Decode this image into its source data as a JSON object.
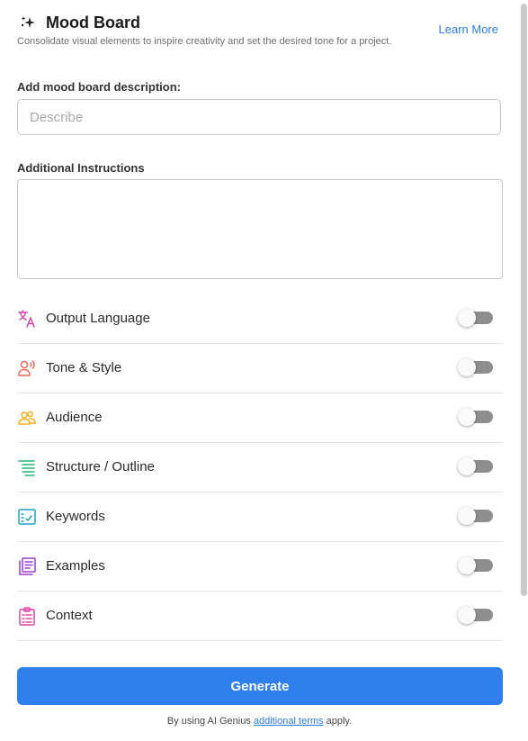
{
  "header": {
    "title": "Mood Board",
    "subtitle": "Consolidate visual elements to inspire creativity and set the desired tone for a project.",
    "learn_more": "Learn More"
  },
  "description": {
    "label": "Add mood board description:",
    "placeholder": "Describe",
    "value": ""
  },
  "instructions": {
    "label": "Additional Instructions",
    "value": ""
  },
  "options": [
    {
      "label": "Output Language",
      "icon": "translate-icon",
      "color": "#d63fa8",
      "enabled": false
    },
    {
      "label": "Tone & Style",
      "icon": "speaking-person-icon",
      "color": "#ef6b5b",
      "enabled": false
    },
    {
      "label": "Audience",
      "icon": "people-icon",
      "color": "#f2b01e",
      "enabled": false
    },
    {
      "label": "Structure / Outline",
      "icon": "outline-lines-icon",
      "color": "#22b573",
      "enabled": false
    },
    {
      "label": "Keywords",
      "icon": "keyword-checklist-icon",
      "color": "#1ba2c2",
      "enabled": false
    },
    {
      "label": "Examples",
      "icon": "document-stack-icon",
      "color": "#9b3fd6",
      "enabled": false
    },
    {
      "label": "Context",
      "icon": "clipboard-icon",
      "color": "#e046a8",
      "enabled": false
    }
  ],
  "generate_label": "Generate",
  "footer": {
    "prefix": "By using AI Genius ",
    "link": "additional terms",
    "suffix": " apply."
  },
  "colors": {
    "accent": "#2f80ed",
    "link": "#2b7de0",
    "toggle_off": "#8e8e8e"
  }
}
